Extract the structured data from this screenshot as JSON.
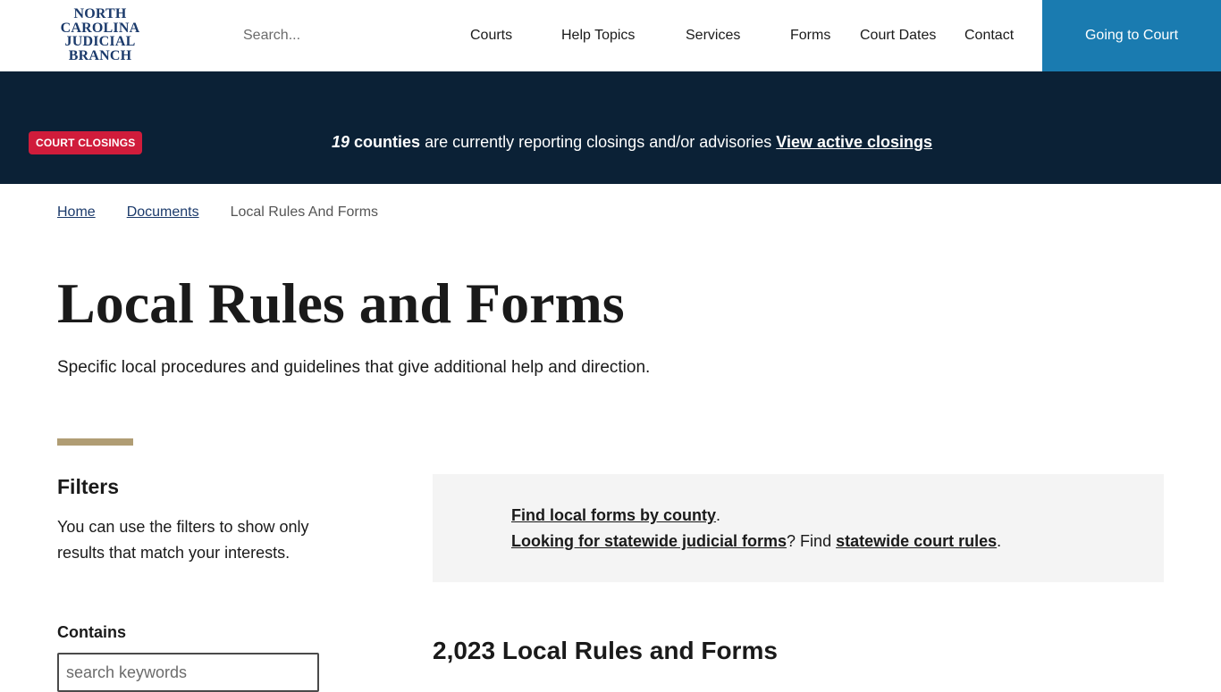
{
  "header": {
    "logo_lines": [
      "NORTH",
      "CAROLINA",
      "JUDICIAL",
      "BRANCH"
    ],
    "search_placeholder": "Search...",
    "nav": [
      "Courts",
      "Help Topics",
      "Services",
      "Forms",
      "Court Dates",
      "Contact"
    ],
    "cta_label": "Going to Court"
  },
  "alert": {
    "badge": "COURT CLOSINGS",
    "count": "19",
    "counties_word": "counties",
    "message": "are currently reporting closings and/or advisories",
    "link": "View active closings"
  },
  "breadcrumb": {
    "home": "Home",
    "documents": "Documents",
    "current": "Local Rules And Forms"
  },
  "page": {
    "title": "Local Rules and Forms",
    "subtitle": "Specific local procedures and guidelines that give additional help and direction."
  },
  "filters": {
    "title": "Filters",
    "description": "You can use the filters to show only results that match your interests.",
    "contains_label": "Contains",
    "keyword_placeholder": "search keywords"
  },
  "info": {
    "link1": "Find local forms by county",
    "period1": ".",
    "link2": "Looking for statewide judicial forms",
    "mid_text": "? Find ",
    "link3": "statewide court rules",
    "period2": "."
  },
  "results": {
    "heading": "2,023 Local Rules and Forms"
  },
  "colors": {
    "navy": "#0b2136",
    "cta_blue": "#1a7bb0",
    "alert_red": "#d01c3b",
    "accent_tan": "#b09d74",
    "logo_blue": "#1b3a6b"
  }
}
